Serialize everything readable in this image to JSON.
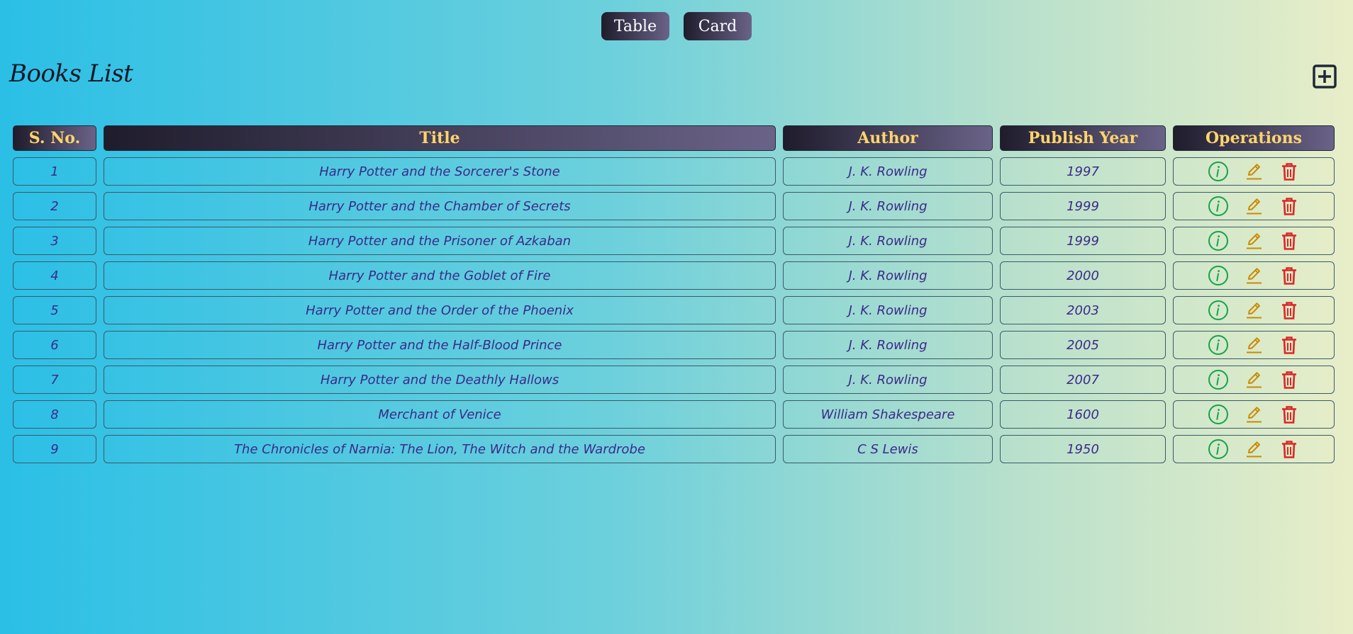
{
  "view_toggle": {
    "table_label": "Table",
    "card_label": "Card"
  },
  "page": {
    "title": "Books List"
  },
  "table": {
    "headers": {
      "sno": "S. No.",
      "title": "Title",
      "author": "Author",
      "year": "Publish Year",
      "operations": "Operations"
    },
    "rows": [
      {
        "sno": "1",
        "title": "Harry Potter and the Sorcerer's Stone",
        "author": "J. K. Rowling",
        "year": "1997"
      },
      {
        "sno": "2",
        "title": "Harry Potter and the Chamber of Secrets",
        "author": "J. K. Rowling",
        "year": "1999"
      },
      {
        "sno": "3",
        "title": "Harry Potter and the Prisoner of Azkaban",
        "author": "J. K. Rowling",
        "year": "1999"
      },
      {
        "sno": "4",
        "title": "Harry Potter and the Goblet of Fire",
        "author": "J. K. Rowling",
        "year": "2000"
      },
      {
        "sno": "5",
        "title": "Harry Potter and the Order of the Phoenix",
        "author": "J. K. Rowling",
        "year": "2003"
      },
      {
        "sno": "6",
        "title": "Harry Potter and the Half-Blood Prince",
        "author": "J. K. Rowling",
        "year": "2005"
      },
      {
        "sno": "7",
        "title": "Harry Potter and the Deathly Hallows",
        "author": "J. K. Rowling",
        "year": "2007"
      },
      {
        "sno": "8",
        "title": "Merchant of Venice",
        "author": "William Shakespeare",
        "year": "1600"
      },
      {
        "sno": "9",
        "title": "The Chronicles of Narnia: The Lion, The Witch and the Wardrobe",
        "author": "C S Lewis",
        "year": "1950"
      }
    ]
  },
  "icons": {
    "add": "plus-square-icon",
    "info": "info-circle-icon",
    "edit": "pencil-icon",
    "delete": "trash-icon"
  },
  "colors": {
    "info": "#16a34a",
    "edit": "#ca8a04",
    "delete": "#dc2626",
    "header_text": "#ffd56a",
    "cell_text": "#3b2a8a"
  }
}
